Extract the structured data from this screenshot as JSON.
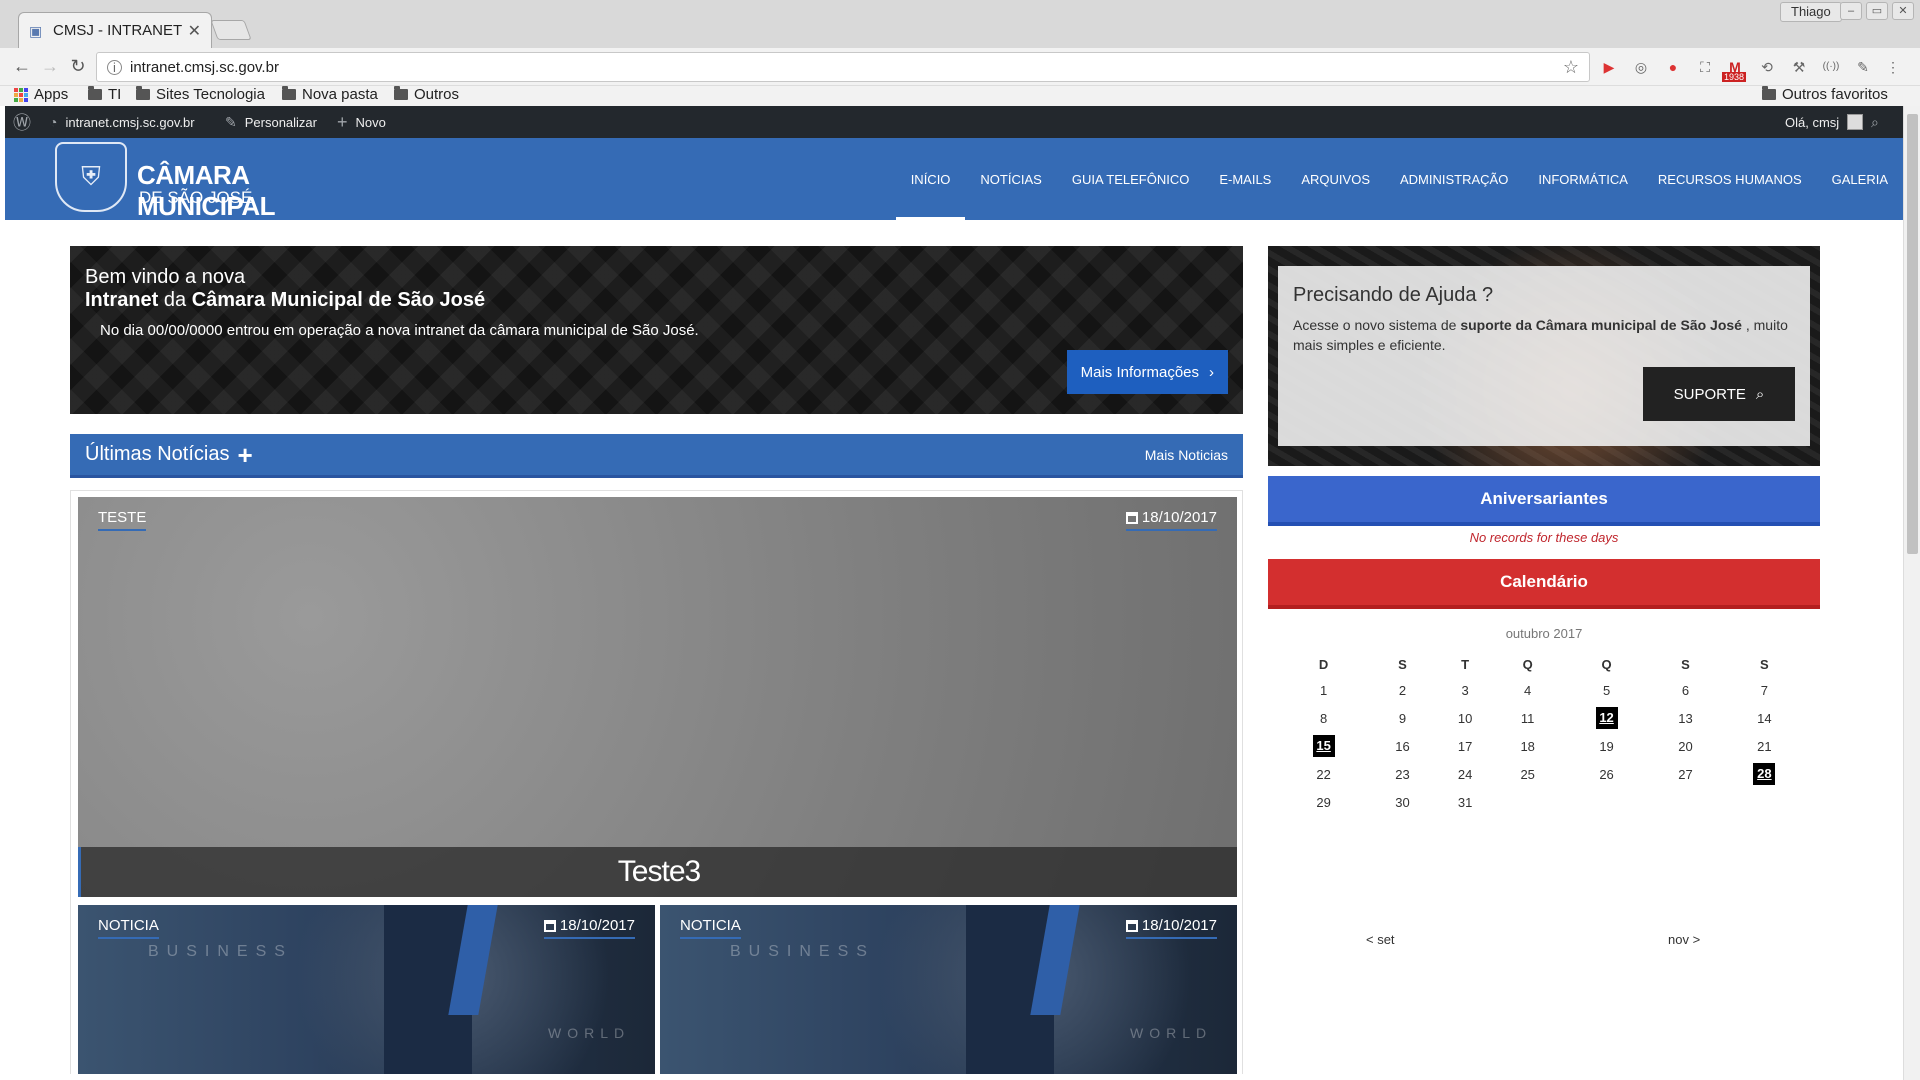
{
  "browser": {
    "tab_title": "CMSJ - INTRANET",
    "profile": "Thiago",
    "url": "intranet.cmsj.sc.gov.br",
    "bookmarks": [
      "Apps",
      "TI",
      "Sites Tecnologia",
      "Nova pasta",
      "Outros"
    ],
    "other_bookmarks": "Outros favoritos",
    "gmail_badge": "1938"
  },
  "adminbar": {
    "site": "intranet.cmsj.sc.gov.br",
    "customize": "Personalizar",
    "new": "Novo",
    "greeting": "Olá, cmsj"
  },
  "header": {
    "logo_line1": "CÂMARA MUNICIPAL",
    "logo_line2": "DE SÃO JOSÉ",
    "menu": [
      "INÍCIO",
      "NOTÍCIAS",
      "GUIA TELEFÔNICO",
      "E-MAILS",
      "ARQUIVOS",
      "ADMINISTRAÇÃO",
      "INFORMÁTICA",
      "RECURSOS HUMANOS",
      "GALERIA"
    ],
    "active_menu": "INÍCIO"
  },
  "welcome": {
    "line1": "Bem vindo a nova",
    "line2_a": "Intranet",
    "line2_b": " da ",
    "line2_c": "Câmara Municipal de São José",
    "text": "No dia 00/00/0000 entrou em operação a nova intranet da câmara municipal de São José.",
    "button": "Mais Informações"
  },
  "help": {
    "title": "Precisando de Ajuda ?",
    "text_a": "Acesse o novo sistema de ",
    "text_b": "suporte da Câmara municipal de São José",
    "text_c": " , muito mais simples e eficiente.",
    "button": "SUPORTE"
  },
  "news": {
    "title": "Últimas Notícias",
    "more": "Mais Noticias",
    "featured": {
      "tag": "TESTE",
      "date": "18/10/2017",
      "title": "Teste3"
    },
    "cards": [
      {
        "tag": "NOTICIA",
        "date": "18/10/2017",
        "img_text1": "BUSINESS",
        "img_text2": "WORLD"
      },
      {
        "tag": "NOTICIA",
        "date": "18/10/2017",
        "img_text1": "BUSINESS",
        "img_text2": "WORLD"
      }
    ]
  },
  "birthdays": {
    "title": "Aniversariantes",
    "empty": "No records for these days"
  },
  "calendar": {
    "title": "Calendário",
    "month": "outubro 2017",
    "weekdays": [
      "D",
      "S",
      "T",
      "Q",
      "Q",
      "S",
      "S"
    ],
    "weeks": [
      [
        "1",
        "2",
        "3",
        "4",
        "5",
        "6",
        "7"
      ],
      [
        "8",
        "9",
        "10",
        "11",
        "12",
        "13",
        "14"
      ],
      [
        "15",
        "16",
        "17",
        "18",
        "19",
        "20",
        "21"
      ],
      [
        "22",
        "23",
        "24",
        "25",
        "26",
        "27",
        "28"
      ],
      [
        "29",
        "30",
        "31",
        "",
        "",
        "",
        ""
      ]
    ],
    "highlighted": [
      "12",
      "15",
      "28"
    ],
    "prev": "< set",
    "next": "nov >"
  }
}
